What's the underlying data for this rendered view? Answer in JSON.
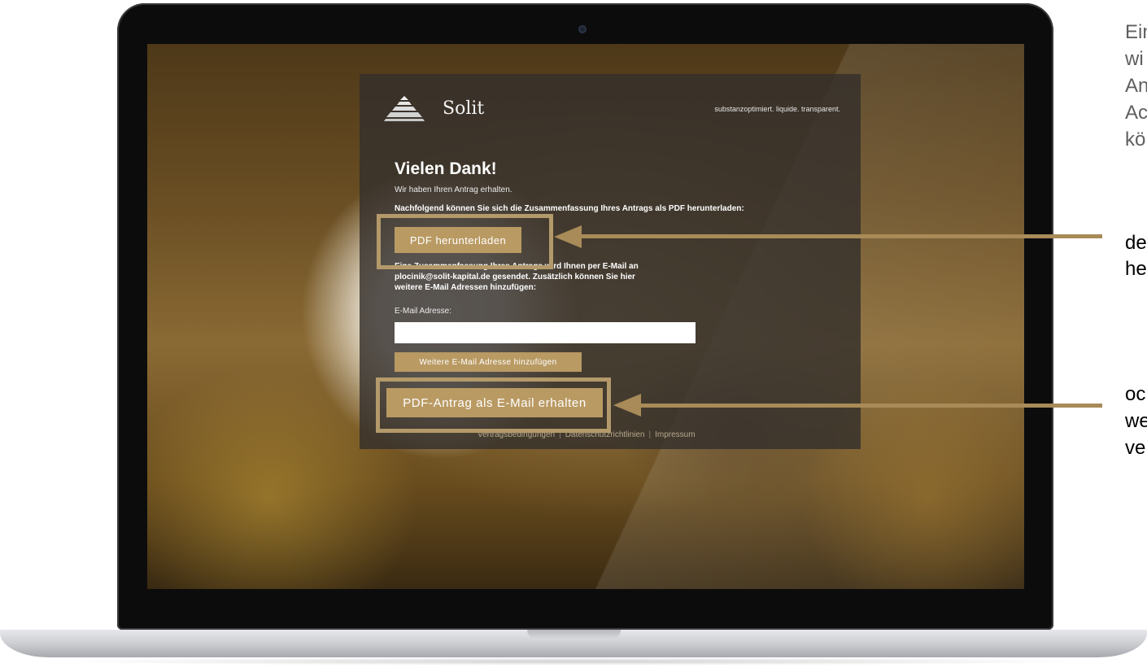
{
  "site": {
    "brand_name": "Solit",
    "tagline": "substanzoptimiert. liquide. transparent."
  },
  "confirmation": {
    "heading": "Vielen Dank!",
    "received": "Wir haben Ihren Antrag erhalten.",
    "instruction": "Nachfolgend können Sie sich die Zusammenfassung Ihres Antrags als PDF herunterladen:",
    "pdf_button": "PDF herunterladen",
    "email_info_line1": "Eine Zusammenfassung Ihres Antrags wird Ihnen per E-Mail an",
    "email_info_line2": "plocinik@solit-kapital.de gesendet. Zusätzlich können Sie hier",
    "email_info_line3": "weitere E-Mail Adressen hinzufügen:",
    "email_label": "E-Mail Adresse:",
    "email_value": "",
    "add_email_button": "Weitere E-Mail Adresse hinzufügen",
    "email_pdf_button": "PDF-Antrag als E-Mail erhalten"
  },
  "footer": {
    "links": [
      "Vertragsbedingungen",
      "Datenschutzrichtlinien",
      "Impressum"
    ],
    "separator": "|"
  },
  "annotation": {
    "intro_lines": [
      "Ein",
      "wi",
      "An",
      "Ac",
      "kö"
    ],
    "callout_pdf_lines": [
      "de",
      "he"
    ],
    "callout_email_lines": [
      "oc",
      "we",
      "ve"
    ]
  },
  "colors": {
    "accent_gold": "#b99a63",
    "panel_dark": "#34302c",
    "highlight_border": "#b49a6a"
  }
}
